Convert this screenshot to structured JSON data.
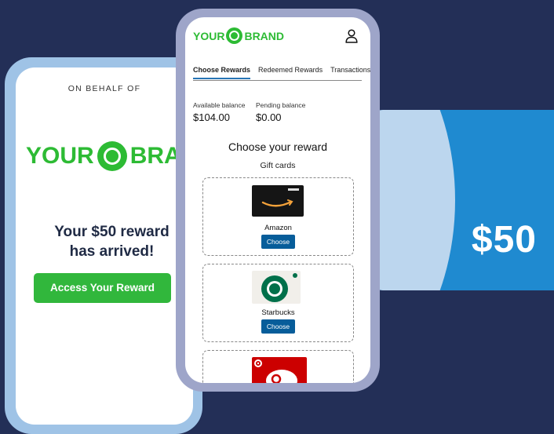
{
  "card": {
    "amount": "$50"
  },
  "left_phone": {
    "on_behalf": "ON BEHALF OF",
    "logo_left": "YOUR",
    "logo_right": "BRAND",
    "headline_line1": "Your $50 reward",
    "headline_line2": "has arrived!",
    "cta_label": "Access Your Reward"
  },
  "right_phone": {
    "logo_left": "YOUR",
    "logo_right": "BRAND",
    "tabs": [
      {
        "label": "Choose Rewards",
        "active": true
      },
      {
        "label": "Redeemed Rewards",
        "active": false
      },
      {
        "label": "Transactions",
        "active": false
      }
    ],
    "balances": {
      "available_label": "Available balance",
      "available_value": "$104.00",
      "pending_label": "Pending balance",
      "pending_value": "$0.00"
    },
    "choose_title": "Choose your reward",
    "section_title": "Gift cards",
    "gift_cards": [
      {
        "name": "Amazon",
        "button": "Choose",
        "icon": "amazon-gift-card-image"
      },
      {
        "name": "Starbucks",
        "button": "Choose",
        "icon": "starbucks-gift-card-image"
      },
      {
        "name": "",
        "button": "",
        "icon": "target-gift-card-image"
      }
    ]
  },
  "colors": {
    "background": "#232f57",
    "brand_green": "#2dbb34",
    "card_blue": "#1f8ad0",
    "button_blue": "#075d9a"
  }
}
